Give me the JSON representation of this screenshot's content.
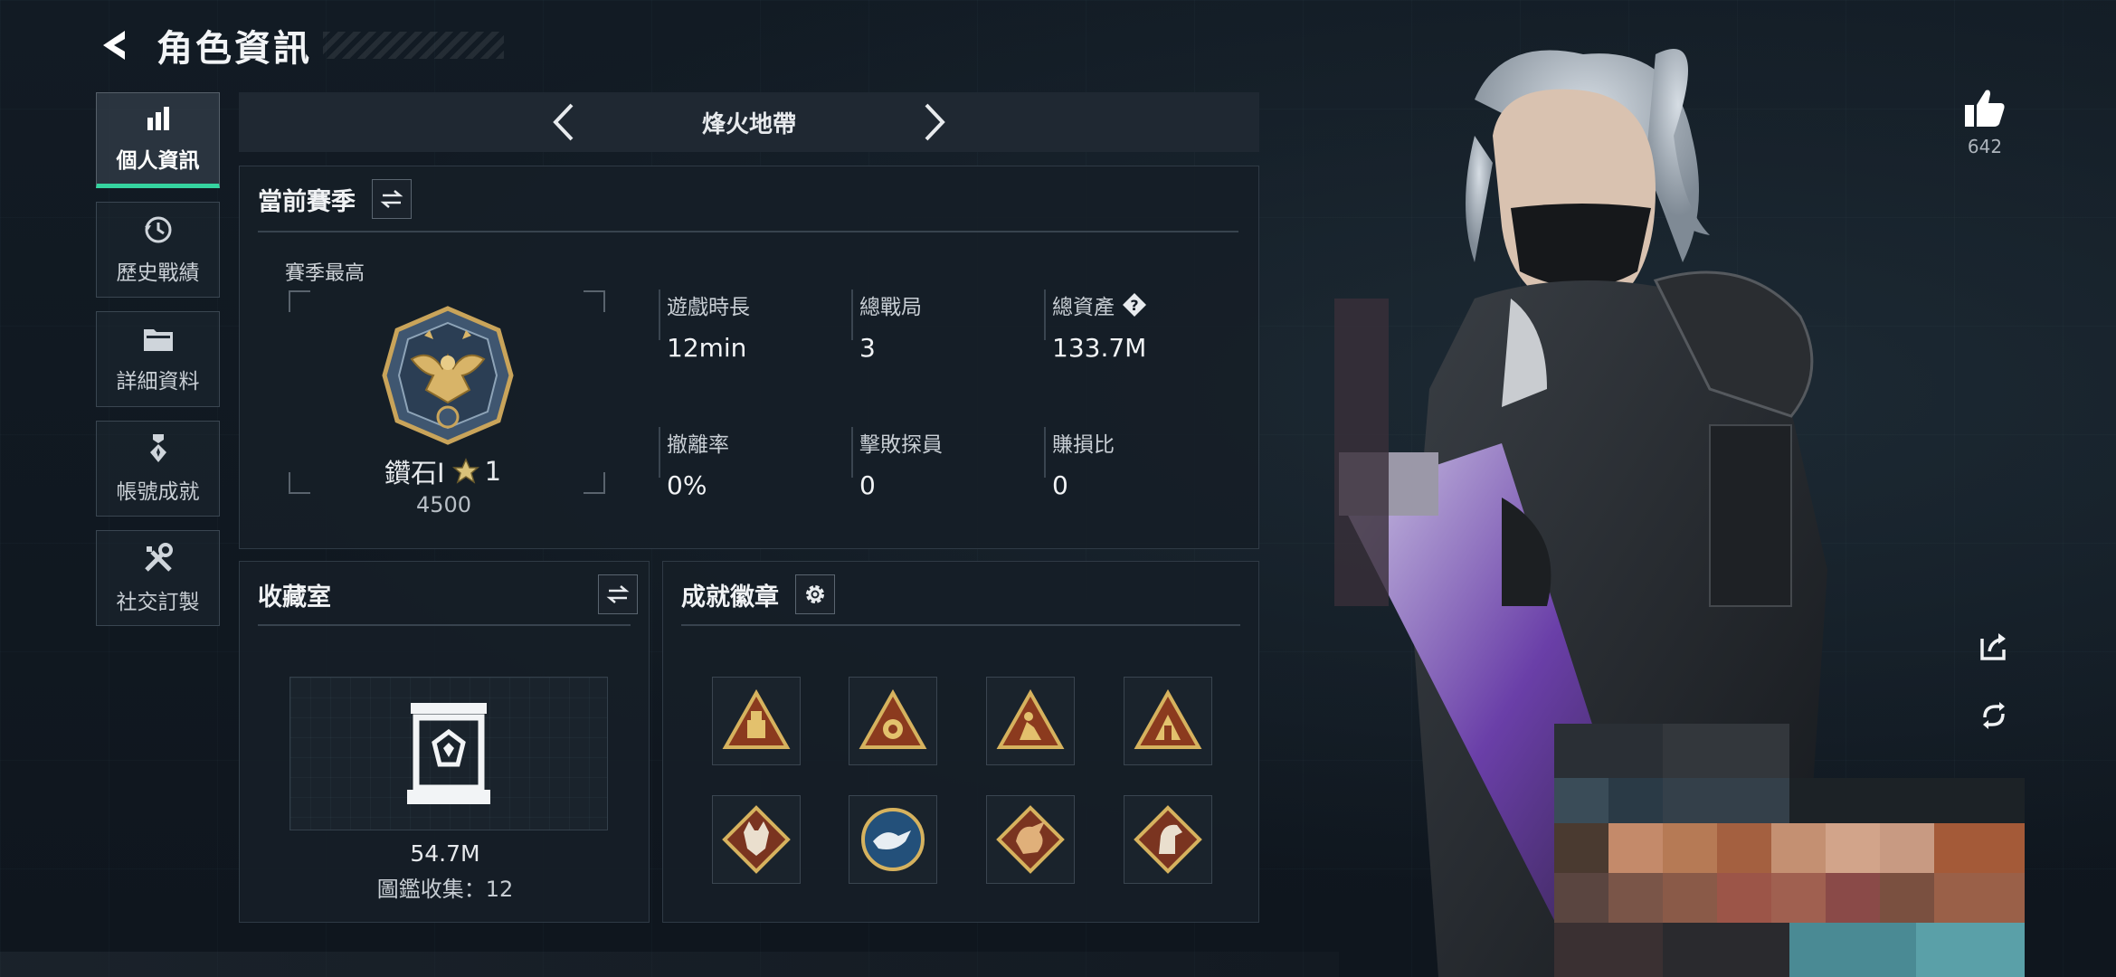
{
  "header": {
    "title": "角色資訊",
    "back_icon": "back-arrow-icon"
  },
  "sidebar": {
    "items": [
      {
        "label": "個人資訊",
        "icon": "stats-bar-icon",
        "active": true
      },
      {
        "label": "歷史戰績",
        "icon": "history-clock-icon",
        "active": false
      },
      {
        "label": "詳細資料",
        "icon": "folder-icon",
        "active": false
      },
      {
        "label": "帳號成就",
        "icon": "achievement-medal-icon",
        "active": false
      },
      {
        "label": "社交訂製",
        "icon": "tools-icon",
        "active": false
      }
    ]
  },
  "mode_selector": {
    "current": "烽火地帶"
  },
  "season": {
    "title": "當前賽季",
    "best_label": "賽季最高",
    "rank_name": "鑽石I",
    "rank_stars": "1",
    "rank_score": "4500",
    "stats": [
      {
        "label": "遊戲時長",
        "value": "12min"
      },
      {
        "label": "總戰局",
        "value": "3"
      },
      {
        "label": "總資產",
        "value": "133.7M",
        "help": true
      },
      {
        "label": "撤離率",
        "value": "0%"
      },
      {
        "label": "擊敗探員",
        "value": "0"
      },
      {
        "label": "賺損比",
        "value": "0"
      }
    ]
  },
  "collection": {
    "title": "收藏室",
    "value": "54.7M",
    "count_text": "圖鑑收集：12"
  },
  "badges": {
    "title": "成就徽章",
    "items": [
      "triangle-badge-icon",
      "triangle-badge-icon",
      "triangle-badge-icon",
      "triangle-badge-icon",
      "wolf-badge-icon",
      "eagle-badge-icon",
      "dragon-badge-icon",
      "horse-badge-icon"
    ]
  },
  "likes": {
    "count": "642"
  },
  "colors": {
    "accent": "#35d4a0",
    "background": "#111923",
    "panel": "#161e27",
    "gold": "#c9a45a"
  }
}
